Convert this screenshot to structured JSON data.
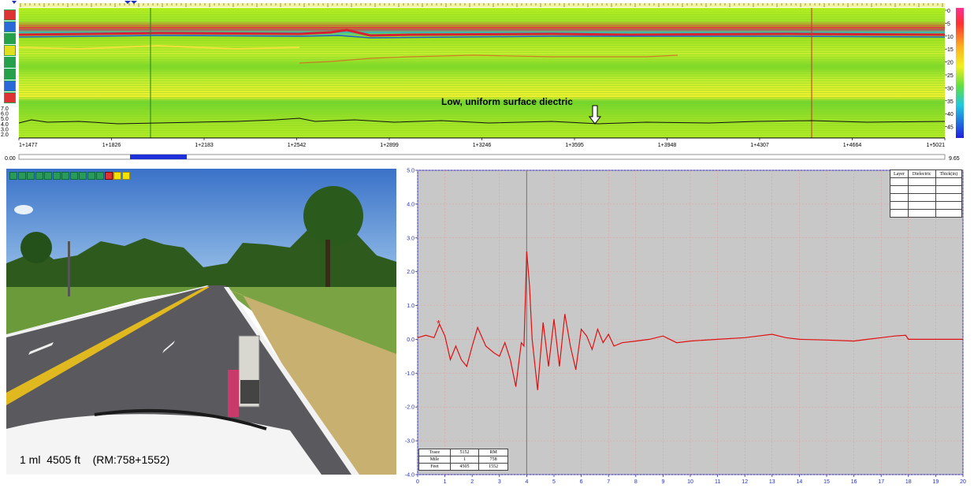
{
  "gpr": {
    "left_axis_labels": [
      "7.0",
      "6.0",
      "5.0",
      "4.0",
      "3.0",
      "2.0"
    ],
    "right_scale_labels": [
      "0",
      "5",
      "10",
      "15",
      "20",
      "25",
      "30",
      "35",
      "40",
      "45"
    ],
    "x_tick_labels": [
      "1+1477",
      "1+1826",
      "1+2183",
      "1+2542",
      "1+2899",
      "1+3246",
      "1+3595",
      "1+3948",
      "1+4307",
      "1+4664",
      "1+5021"
    ],
    "annotation": "Low, uniform surface diectric",
    "slider_min": "0.00",
    "slider_max": "9.65",
    "slider_position": 0.12
  },
  "toolbar_icons": [
    "gpr-color-icon",
    "gpr-arrow-icon",
    "gpr-zoom-icon",
    "gpr-filter-icon",
    "gpr-layer-icon",
    "gpr-marker-icon",
    "gpr-select-icon",
    "gpr-compare-icon"
  ],
  "video_toolbar_icons": [
    "first-frame-icon",
    "prev-fast-icon",
    "prev-icon",
    "stop-icon",
    "play-icon",
    "next-icon",
    "next-fast-icon",
    "last-frame-icon",
    "loop-icon",
    "snapshot-icon",
    "settings-icon",
    "record-icon",
    "mark-icon",
    "export-icon"
  ],
  "photo": {
    "caption": "1 ml  4505 ft    (RM:758+1552)"
  },
  "waveform": {
    "y_ticks": [
      "5.0",
      "4.0",
      "3.0",
      "2.0",
      "1.0",
      "0.0",
      "-1.0",
      "-2.0",
      "-3.0",
      "-4.0"
    ],
    "x_ticks": [
      "0",
      "1",
      "2",
      "3",
      "4",
      "5",
      "6",
      "7",
      "8",
      "9",
      "10",
      "11",
      "12",
      "13",
      "14",
      "15",
      "16",
      "17",
      "18",
      "19",
      "20"
    ],
    "cursor_x": 4,
    "layer_table_headers": [
      "Layer",
      "Dielectric",
      "Thick(in)"
    ],
    "trace_table": [
      [
        "Trace",
        "5152",
        "RM"
      ],
      [
        "Mile",
        "1",
        "758"
      ],
      [
        "Feet",
        "4505",
        "1552"
      ]
    ],
    "colors": {
      "plot_bg": "#c8c8c8",
      "signal": "#e01010",
      "axis": "#2030c0"
    }
  },
  "chart_data": {
    "type": "line",
    "xlim": [
      0,
      20
    ],
    "ylim": [
      -4,
      5
    ],
    "grid": true,
    "x": [
      0,
      0.3,
      0.6,
      0.8,
      1.0,
      1.2,
      1.4,
      1.6,
      1.8,
      2.0,
      2.2,
      2.5,
      2.8,
      3.0,
      3.2,
      3.4,
      3.6,
      3.8,
      3.9,
      4.0,
      4.1,
      4.2,
      4.4,
      4.5,
      4.6,
      4.8,
      5.0,
      5.2,
      5.4,
      5.6,
      5.8,
      6.0,
      6.2,
      6.4,
      6.6,
      6.8,
      7.0,
      7.2,
      7.5,
      8.0,
      8.5,
      9.0,
      9.5,
      10.0,
      11.0,
      12.0,
      13.0,
      13.5,
      14.0,
      15.0,
      16.0,
      16.5,
      17.0,
      17.5,
      17.9,
      18.0,
      18.5,
      19.0,
      20.0
    ],
    "series": [
      {
        "values": [
          0.05,
          0.12,
          0.05,
          0.45,
          0.1,
          -0.6,
          -0.2,
          -0.6,
          -0.8,
          -0.2,
          0.35,
          -0.2,
          -0.4,
          -0.5,
          -0.1,
          -0.6,
          -1.4,
          -0.1,
          -0.2,
          2.6,
          1.6,
          0.0,
          -1.5,
          -0.5,
          0.5,
          -0.8,
          0.6,
          -0.8,
          0.75,
          -0.2,
          -0.9,
          0.3,
          0.1,
          -0.3,
          0.3,
          -0.1,
          0.15,
          -0.2,
          -0.1,
          -0.05,
          0.0,
          0.1,
          -0.1,
          -0.05,
          0.0,
          0.05,
          0.15,
          0.05,
          0.0,
          -0.02,
          -0.05,
          0.0,
          0.05,
          0.1,
          0.12,
          0.0,
          0.0,
          0.0,
          0.0
        ]
      }
    ]
  }
}
